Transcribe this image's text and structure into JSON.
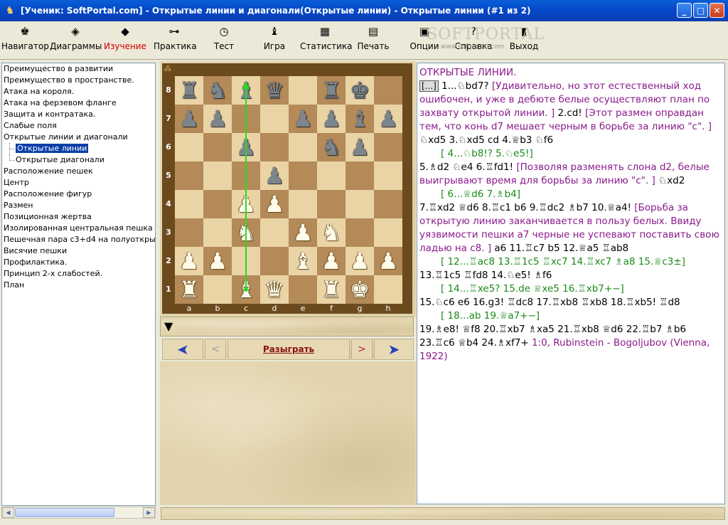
{
  "window": {
    "title": "[Ученик: SoftPortal.com]  - Открытые линии и диагонали(Открытые линии) - Открытые линии (#1 из 2)",
    "buttons": {
      "minimize": "_",
      "maximize": "□",
      "close": "✕"
    }
  },
  "toolbar": {
    "items": [
      {
        "label": "Навигатор",
        "icon": "navigator-icon",
        "glyph": "♚"
      },
      {
        "label": "Диаграммы",
        "icon": "diagrams-icon",
        "glyph": "◈"
      },
      {
        "label": "Изучение",
        "icon": "book-icon",
        "glyph": "◆"
      },
      {
        "label": "Практика",
        "icon": "key-icon",
        "glyph": "⊶"
      },
      {
        "label": "Тест",
        "icon": "clock-icon",
        "glyph": "◷"
      },
      {
        "label": "Игра",
        "icon": "bishop-icon",
        "glyph": "♝"
      },
      {
        "label": "Статистика",
        "icon": "table-icon",
        "glyph": "▦"
      },
      {
        "label": "Печать",
        "icon": "printer-icon",
        "glyph": "▤"
      },
      {
        "label": "Опции",
        "icon": "options-icon",
        "glyph": "▣"
      },
      {
        "label": "Справка",
        "icon": "help-icon",
        "glyph": "?"
      },
      {
        "label": "Выход",
        "icon": "exit-icon",
        "glyph": "▮"
      }
    ],
    "active": "Изучение",
    "watermark": "SOFTPORTAL",
    "watermark_url": "www.softportal.com"
  },
  "tree": [
    {
      "label": "Преимущество в развитии",
      "child": false
    },
    {
      "label": "Преимущество в пространстве.",
      "child": false
    },
    {
      "label": "Атака на короля.",
      "child": false
    },
    {
      "label": "Атака на ферзевом фланге",
      "child": false
    },
    {
      "label": "Защита и контратака.",
      "child": false
    },
    {
      "label": "Слабые поля",
      "child": false
    },
    {
      "label": "Открытые линии и диагонали",
      "child": false
    },
    {
      "label": "Открытые линии",
      "child": true,
      "selected": true
    },
    {
      "label": "Открытые диагонали",
      "child": true,
      "last": true
    },
    {
      "label": "Расположение пешек",
      "child": false
    },
    {
      "label": "Центр",
      "child": false
    },
    {
      "label": "Расположение фигур",
      "child": false
    },
    {
      "label": "Размен",
      "child": false
    },
    {
      "label": "Позиционная жертва",
      "child": false
    },
    {
      "label": "Изолированная центральная пешка",
      "child": false
    },
    {
      "label": "Пешечная пара c3+d4 на полуоткрыт",
      "child": false
    },
    {
      "label": "Висячие пешки",
      "child": false
    },
    {
      "label": "Профилактика.",
      "child": false
    },
    {
      "label": "Принцип 2-х слабостей.",
      "child": false
    },
    {
      "label": "План",
      "child": false
    }
  ],
  "board": {
    "files": [
      "a",
      "b",
      "c",
      "d",
      "e",
      "f",
      "g",
      "h"
    ],
    "ranks": [
      "8",
      "7",
      "6",
      "5",
      "4",
      "3",
      "2",
      "1"
    ],
    "corner_glyph": "⁂",
    "pieces": {
      "a8": "bR",
      "b8": "bN",
      "c8": "bB",
      "d8": "bQ",
      "f8": "bR",
      "g8": "bK",
      "a7": "bP",
      "b7": "bP",
      "e7": "bP",
      "f7": "bP",
      "g7": "bB",
      "h7": "bP",
      "c6": "bP",
      "f6": "bN",
      "g6": "bP",
      "d5": "bP",
      "c4": "wP",
      "d4": "wP",
      "c3": "wN",
      "e3": "wP",
      "f3": "wN",
      "a2": "wP",
      "b2": "wP",
      "e2": "wB",
      "f2": "wP",
      "g2": "wP",
      "h2": "wP",
      "a1": "wR",
      "c1": "wB",
      "d1": "wQ",
      "f1": "wR",
      "g1": "wK"
    },
    "arrow": {
      "from": "c1",
      "to": "c8",
      "color": "#22dd22"
    },
    "side_to_move": "black"
  },
  "navigation": {
    "first": "➤",
    "prev": "<",
    "play": "Разыграть",
    "next": ">",
    "last": "➤"
  },
  "text": {
    "heading": "ОТКРЫТЫЕ ЛИНИИ.",
    "bracket": "[...]"
  }
}
